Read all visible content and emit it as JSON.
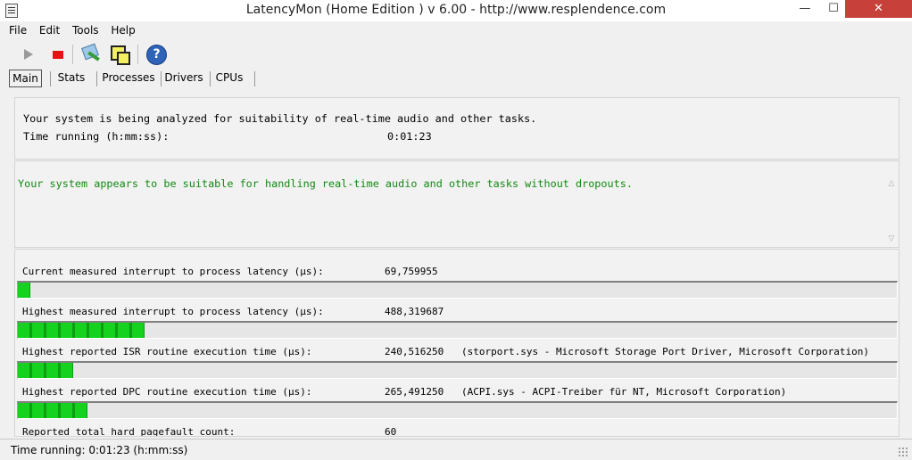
{
  "window": {
    "title": "LatencyMon  (Home Edition )  v 6.00 - http://www.resplendence.com",
    "min_glyph": "—",
    "max_glyph": "☐",
    "close_glyph": "✕"
  },
  "menu": [
    "File",
    "Edit",
    "Tools",
    "Help"
  ],
  "toolbar": {
    "icons": [
      "play-icon",
      "stop-icon",
      "tools-icon",
      "windows-icon",
      "help-icon"
    ],
    "help_glyph": "?"
  },
  "tabs": [
    "Main",
    "Stats",
    "Processes",
    "Drivers",
    "CPUs"
  ],
  "selected_tab": "Main",
  "summary": {
    "analyzing": "Your system is being analyzed for suitability of real-time audio and other tasks.",
    "time_label": "Time running (h:mm:ss):",
    "time_value": "0:01:23"
  },
  "verdict": {
    "text": "Your system appears to be suitable for handling real-time audio and other tasks without dropouts.",
    "color": "#128a12"
  },
  "metrics": [
    {
      "label": "Current measured interrupt to process latency (µs):",
      "value": "69,759955",
      "extra": "",
      "bar_fraction": 0.014
    },
    {
      "label": "Highest measured interrupt to process latency (µs):",
      "value": "488,319687",
      "extra": "",
      "bar_fraction": 0.144
    },
    {
      "label": "Highest reported ISR routine execution time (µs):",
      "value": "240,516250",
      "extra": "(storport.sys - Microsoft Storage Port Driver, Microsoft Corporation)",
      "bar_fraction": 0.063
    },
    {
      "label": "Highest reported DPC routine execution time (µs):",
      "value": "265,491250",
      "extra": "(ACPI.sys - ACPI-Treiber für NT, Microsoft Corporation)",
      "bar_fraction": 0.079
    },
    {
      "label": "Reported total hard pagefault count:",
      "value": "60",
      "extra": "",
      "bar_fraction": null
    }
  ],
  "status": {
    "text": "Time running: 0:01:23  (h:mm:ss)"
  },
  "colors": {
    "bar_fill": "#14d21e",
    "close_button": "#c7403a",
    "stop_icon": "#e81010"
  }
}
